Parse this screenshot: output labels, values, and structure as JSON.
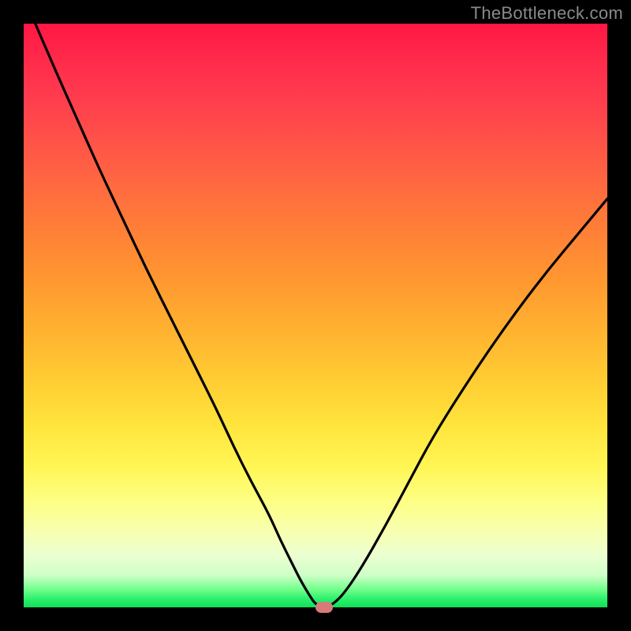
{
  "watermark": "TheBottleneck.com",
  "chart_data": {
    "type": "line",
    "title": "",
    "xlabel": "",
    "ylabel": "",
    "xlim": [
      0,
      100
    ],
    "ylim": [
      0,
      100
    ],
    "grid": false,
    "legend": false,
    "background_gradient": {
      "direction": "vertical",
      "stops": [
        {
          "pos": 0,
          "color": "#ff1744"
        },
        {
          "pos": 20,
          "color": "#ff5248"
        },
        {
          "pos": 40,
          "color": "#ff9030"
        },
        {
          "pos": 60,
          "color": "#ffc932"
        },
        {
          "pos": 80,
          "color": "#fdff85"
        },
        {
          "pos": 95,
          "color": "#cfffc8"
        },
        {
          "pos": 100,
          "color": "#0ee05a"
        }
      ]
    },
    "series": [
      {
        "name": "bottleneck-curve",
        "color": "#000000",
        "x": [
          2,
          5,
          9,
          13,
          17,
          21,
          25,
          29,
          33,
          36,
          39,
          42,
          44,
          46,
          47.5,
          49,
          50,
          51.5,
          53,
          55,
          58,
          62,
          66,
          70,
          75,
          80,
          85,
          90,
          95,
          100
        ],
        "y": [
          100,
          93,
          84,
          75,
          66.5,
          58,
          50,
          42,
          34,
          27.5,
          21.5,
          16,
          11.5,
          7.5,
          4.5,
          2,
          0.5,
          0,
          0.5,
          2.5,
          7,
          14,
          21.5,
          29,
          37,
          44.5,
          51.5,
          58,
          64,
          70
        ]
      }
    ],
    "marker": {
      "name": "optimal-point",
      "x": 51.5,
      "y": 0,
      "color": "#d97a7a",
      "shape": "pill"
    }
  }
}
